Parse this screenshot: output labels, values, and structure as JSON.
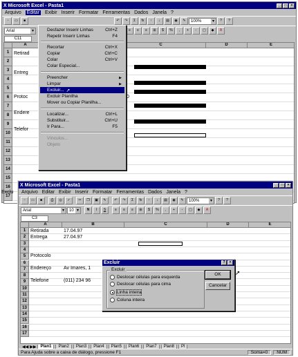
{
  "app": {
    "title": "Microsoft Excel - Pasta1",
    "icon": "excel-app-icon"
  },
  "menubar": [
    "Arquivo",
    "Editar",
    "Exibir",
    "Inserir",
    "Formatar",
    "Ferramentas",
    "Dados",
    "Janela",
    "?"
  ],
  "toolbar": {
    "font": "Arial",
    "font_size": "10",
    "zoom": "100%",
    "sum": "Σ",
    "fx": "fx"
  },
  "namebox1": "C11",
  "edit_menu": {
    "items": [
      {
        "label": "Desfazer Inserir Linhas",
        "shortcut": "Ctrl+Z",
        "enabled": true
      },
      {
        "label": "Repetir Inserir Linhas",
        "shortcut": "F4",
        "enabled": true
      },
      {
        "label": "Recortar",
        "shortcut": "Ctrl+X",
        "enabled": true
      },
      {
        "label": "Copiar",
        "shortcut": "Ctrl+C",
        "enabled": true
      },
      {
        "label": "Colar",
        "shortcut": "Ctrl+V",
        "enabled": true
      },
      {
        "label": "Colar Especial...",
        "shortcut": "",
        "enabled": true
      },
      {
        "label": "Preencher",
        "shortcut": "",
        "enabled": true
      },
      {
        "label": "Limpar",
        "shortcut": "",
        "enabled": true
      },
      {
        "label": "Excluir...",
        "shortcut": "",
        "enabled": true
      },
      {
        "label": "Excluir Planilha",
        "shortcut": "",
        "enabled": true
      },
      {
        "label": "Mover ou Copiar Planilha...",
        "shortcut": "",
        "enabled": true
      },
      {
        "label": "Localizar...",
        "shortcut": "Ctrl+L",
        "enabled": true
      },
      {
        "label": "Substituir...",
        "shortcut": "Ctrl+U",
        "enabled": true
      },
      {
        "label": "Ir Para...",
        "shortcut": "F5",
        "enabled": true
      },
      {
        "label": "Vínculos...",
        "shortcut": "",
        "enabled": false
      },
      {
        "label": "Objeto",
        "shortcut": "",
        "enabled": false
      }
    ]
  },
  "sheet1": {
    "columns": [
      "A",
      "B",
      "C",
      "D",
      "E"
    ],
    "rows": [
      "1",
      "2",
      "3",
      "4",
      "5",
      "6",
      "7",
      "8",
      "9",
      "10",
      "11",
      "12",
      "13",
      "14",
      "15",
      "16",
      "17"
    ],
    "cells": {
      "a1": "Retirad",
      "a3": "Entreg",
      "a6": "Protoc",
      "a8": "Endere",
      "a10": "Telefor",
      "b6_tail": "0"
    }
  },
  "partial_left": [
    "Exclu"
  ],
  "window2": {
    "title": "Microsoft Excel - Pasta1",
    "namebox": "C3",
    "columns": [
      "A",
      "B",
      "C",
      "D",
      "E"
    ],
    "rows": [
      "1",
      "2",
      "3",
      "4",
      "5",
      "6",
      "7",
      "8",
      "9",
      "10",
      "11",
      "12",
      "13",
      "14",
      "15",
      "16",
      "17"
    ],
    "cells": {
      "a1": "Retirada",
      "b1": "17.04.97",
      "a2": "Entrega",
      "b2": "27.04.97",
      "a5": "Protocolo",
      "a7": "Endereço",
      "b7": "Av Imares, 1",
      "a9": "Telefone",
      "b9": "(011) 234 96"
    },
    "tabs": [
      "Plan1",
      "Plan2",
      "Plan3",
      "Plan4",
      "Plan5",
      "Plan6",
      "Plan7",
      "Plan8",
      "Pl"
    ],
    "status": "Para Ajuda sobre a caixa de diálogo, pressione F1",
    "status_sum": "Soma=0",
    "status_num": "NUM"
  },
  "dialog": {
    "title": "Excluir",
    "group_label": "Excluir",
    "options": [
      {
        "label": "Deslocar células para esquerda",
        "checked": false
      },
      {
        "label": "Deslocar células para cima",
        "checked": false
      },
      {
        "label": "Linha inteira",
        "checked": true
      },
      {
        "label": "Coluna inteira",
        "checked": false
      }
    ],
    "ok": "OK",
    "cancel": "Cancelar"
  }
}
